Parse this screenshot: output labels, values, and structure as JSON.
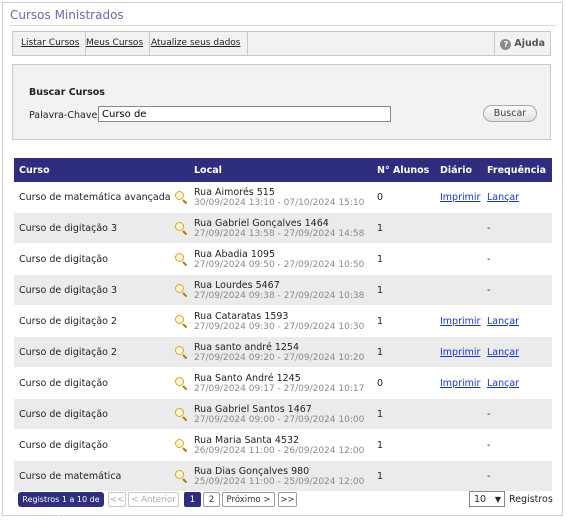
{
  "page": {
    "title": "Cursos Ministrados"
  },
  "menu": {
    "items": [
      "Listar Cursos",
      "Meus Cursos",
      "Atualize seus dados"
    ],
    "help_label": "Ajuda"
  },
  "search": {
    "title": "Buscar Cursos",
    "keyword_label": "Palavra-Chave:",
    "keyword_value": "Curso de",
    "button_label": "Buscar"
  },
  "table": {
    "headers": [
      "Curso",
      "Local",
      "N° Alunos",
      "Diário",
      "Frequência"
    ],
    "rows": [
      {
        "curso": "Curso de matemática avançada",
        "endereco": "Rua Aimorés 515",
        "periodo": "30/09/2024 13:10 - 07/10/2024 15:10",
        "alunos": "0",
        "diario": "Imprimir",
        "frequencia": "Lançar"
      },
      {
        "curso": "Curso de digitação 3",
        "endereco": "Rua Gabriel Gonçalves 1464",
        "periodo": "27/09/2024 13:58 - 27/09/2024 14:58",
        "alunos": "1",
        "diario": "",
        "frequencia": "-"
      },
      {
        "curso": "Curso de digitação",
        "endereco": "Rua Abadia 1095",
        "periodo": "27/09/2024 09:50 - 27/09/2024 10:50",
        "alunos": "1",
        "diario": "",
        "frequencia": "-"
      },
      {
        "curso": "Curso de digitação 3",
        "endereco": "Rua Lourdes 5467",
        "periodo": "27/09/2024 09:38 - 27/09/2024 10:38",
        "alunos": "1",
        "diario": "",
        "frequencia": "-"
      },
      {
        "curso": "Curso de digitação 2",
        "endereco": "Rua Cataratas 1593",
        "periodo": "27/09/2024 09:30 - 27/09/2024 10:30",
        "alunos": "1",
        "diario": "Imprimir",
        "frequencia": "Lançar"
      },
      {
        "curso": "Curso de digitação 2",
        "endereco": "Rua santo andré 1254",
        "periodo": "27/09/2024 09:20 - 27/09/2024 10:20",
        "alunos": "1",
        "diario": "Imprimir",
        "frequencia": "Lançar"
      },
      {
        "curso": "Curso de digitação",
        "endereco": "Rua Santo André 1245",
        "periodo": "27/09/2024 09:17 - 27/09/2024 10:17",
        "alunos": "0",
        "diario": "Imprimir",
        "frequencia": "Lançar"
      },
      {
        "curso": "Curso de digitação",
        "endereco": "Rua Gabriel Santos 1467",
        "periodo": "27/09/2024 09:00 - 27/09/2024 10:00",
        "alunos": "1",
        "diario": "",
        "frequencia": "-"
      },
      {
        "curso": "Curso de digitação",
        "endereco": "Rua Maria Santa 4532",
        "periodo": "26/09/2024 11:00 - 26/09/2024 12:00",
        "alunos": "1",
        "diario": "",
        "frequencia": "-"
      },
      {
        "curso": "Curso de matemática",
        "endereco": "Rua Dias Gonçalves 980",
        "periodo": "25/09/2024 11:00 - 25/09/2024 12:00",
        "alunos": "1",
        "diario": "",
        "frequencia": "-"
      }
    ]
  },
  "pagination": {
    "records_label": "Registros 1 a 10 de 11",
    "first": "<<",
    "previous": "< Anterior",
    "pages": [
      "1",
      "2"
    ],
    "current_page": "1",
    "next": "Próximo >",
    "last": ">>",
    "page_size": "10",
    "page_size_label": "Registros"
  },
  "icons": {
    "location_search": "magnifier-icon",
    "help": "help-circle-icon",
    "select": "chevron-down-icon"
  },
  "colors": {
    "header_bg": "#2f2d7e",
    "title": "#6e6aa8",
    "link": "#1a35c7",
    "row_alt": "#ebebeb"
  }
}
